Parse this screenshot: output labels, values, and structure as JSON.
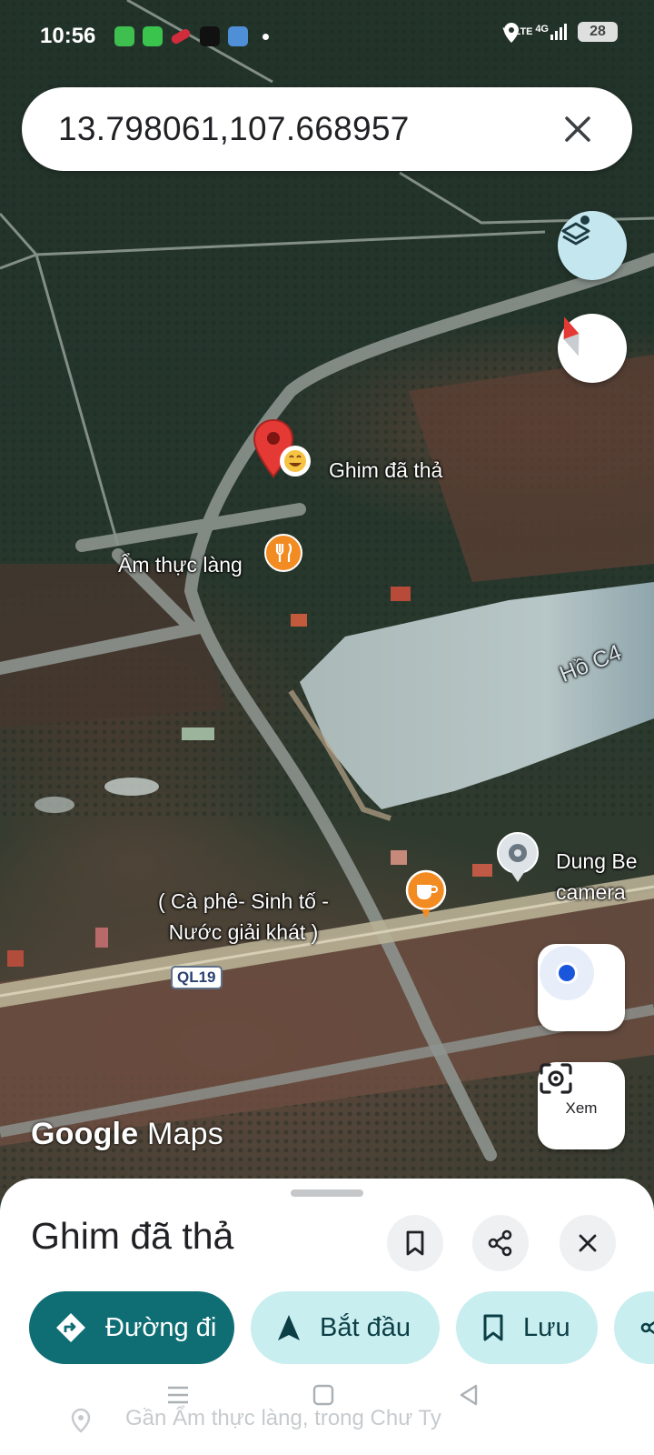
{
  "status_bar": {
    "time": "10:56",
    "network_label": "VoLTE",
    "signal_label": "4G",
    "battery": "28"
  },
  "search": {
    "value": "13.798061,107.668957"
  },
  "map": {
    "dropped_pin_label": "Ghim đã thả",
    "restaurant_label": "Ẩm thực làng",
    "lake_label": "Hồ C4",
    "cafe_label_line1": "( Cà phê- Sinh tố -",
    "cafe_label_line2": "Nước giải khát )",
    "shop_label_line1": "Dung Be",
    "shop_label_line2": "camera",
    "road_shield": "QL19",
    "watermark_brand": "Google",
    "watermark_product": "Maps",
    "lens_label": "Xem"
  },
  "sheet": {
    "title": "Ghim đã thả",
    "directions_label": "Đường đi",
    "start_label": "Bắt đầu",
    "save_label": "Lưu",
    "address": "Gần Ẩm thực làng, trong Chư Ty"
  },
  "colors": {
    "accent": "#0f6e74",
    "chip_bg": "#c8eef0",
    "pin_red": "#e53935",
    "cafe_orange": "#f28b22"
  },
  "icons": [
    "close-icon",
    "layers-icon",
    "compass-icon",
    "my-location-icon",
    "lens-icon",
    "bookmark-icon",
    "share-icon",
    "directions-icon",
    "navigation-arrow-icon",
    "location-pin-icon"
  ]
}
